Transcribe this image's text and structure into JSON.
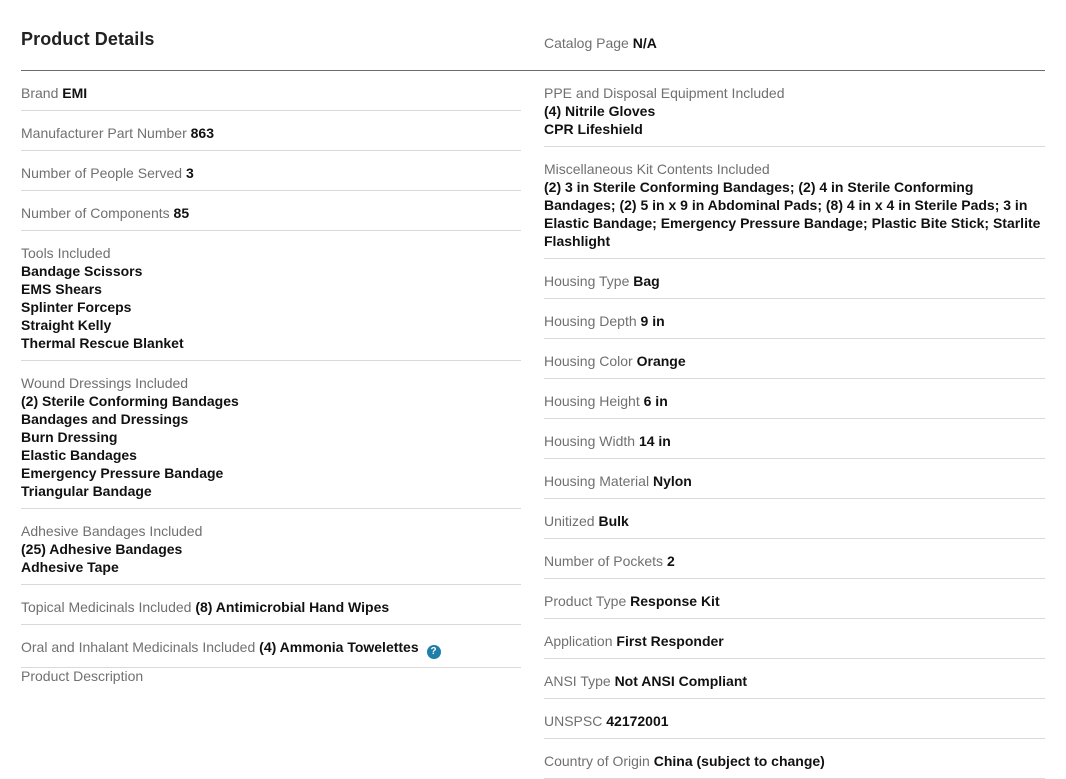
{
  "section_title": "Product Details",
  "catalog": {
    "label": "Catalog Page",
    "value": "N/A"
  },
  "left": {
    "brand": {
      "label": "Brand",
      "value": "EMI"
    },
    "mpn": {
      "label": "Manufacturer Part Number",
      "value": "863"
    },
    "people": {
      "label": "Number of People Served",
      "value": "3"
    },
    "components": {
      "label": "Number of Components",
      "value": "85"
    },
    "tools": {
      "label": "Tools Included",
      "values": [
        "Bandage Scissors",
        "EMS Shears",
        "Splinter Forceps",
        "Straight Kelly",
        "Thermal Rescue Blanket"
      ]
    },
    "wound": {
      "label": "Wound Dressings Included",
      "values": [
        "(2) Sterile Conforming Bandages",
        "Bandages and Dressings",
        "Burn Dressing",
        "Elastic Bandages",
        "Emergency Pressure Bandage",
        "Triangular Bandage"
      ]
    },
    "adhesive": {
      "label": "Adhesive Bandages Included",
      "values": [
        "(25) Adhesive Bandages",
        "Adhesive Tape"
      ]
    },
    "topical": {
      "label": "Topical Medicinals Included",
      "value": "(8) Antimicrobial Hand Wipes"
    },
    "oral": {
      "label": "Oral and Inhalant Medicinals Included",
      "value": "(4) Ammonia Towelettes",
      "help_icon": "?"
    }
  },
  "right": {
    "ppe": {
      "label": "PPE and Disposal Equipment Included",
      "values": [
        "(4) Nitrile Gloves",
        "CPR Lifeshield"
      ]
    },
    "misc": {
      "label": "Miscellaneous Kit Contents Included",
      "value": "(2) 3 in Sterile Conforming Bandages; (2) 4 in Sterile Conforming Bandages; (2) 5 in x 9 in Abdominal Pads; (8) 4 in x 4 in Sterile Pads; 3 in Elastic Bandage; Emergency Pressure Bandage; Plastic Bite Stick; Starlite Flashlight"
    },
    "housing_type": {
      "label": "Housing Type",
      "value": "Bag"
    },
    "housing_depth": {
      "label": "Housing Depth",
      "value": "9 in"
    },
    "housing_color": {
      "label": "Housing Color",
      "value": "Orange"
    },
    "housing_height": {
      "label": "Housing Height",
      "value": "6 in"
    },
    "housing_width": {
      "label": "Housing Width",
      "value": "14 in"
    },
    "housing_material": {
      "label": "Housing Material",
      "value": "Nylon"
    },
    "unitized": {
      "label": "Unitized",
      "value": "Bulk"
    },
    "pockets": {
      "label": "Number of Pockets",
      "value": "2"
    },
    "product_type": {
      "label": "Product Type",
      "value": "Response Kit"
    },
    "application": {
      "label": "Application",
      "value": "First Responder"
    },
    "ansi": {
      "label": "ANSI Type",
      "value": "Not ANSI Compliant"
    },
    "unspsc": {
      "label": "UNSPSC",
      "value": "42172001"
    },
    "origin": {
      "label": "Country of Origin",
      "value": "China (subject to change)"
    }
  },
  "description_heading": "Product Description",
  "colors": {
    "label": "#707070",
    "value": "#111111",
    "divider": "#d9d9d9",
    "header_rule": "#6b6b6b",
    "help_icon": "#1f7fa8"
  }
}
